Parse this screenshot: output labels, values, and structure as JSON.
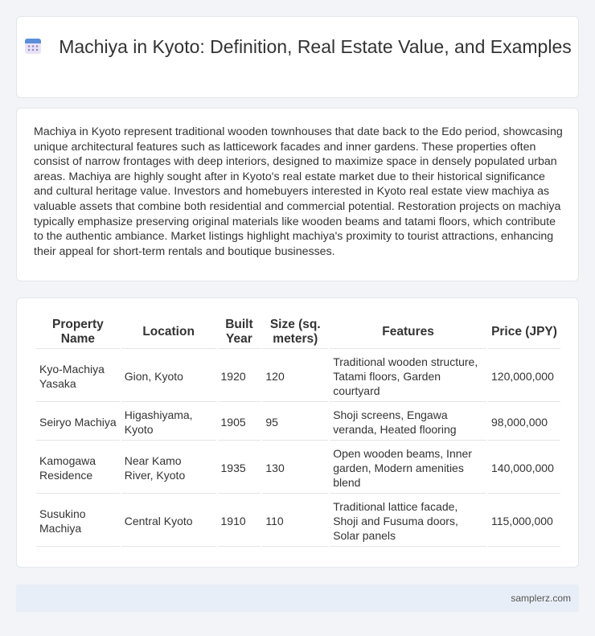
{
  "header": {
    "icon": "calendar-icon",
    "title": "Machiya in Kyoto: Definition, Real Estate Value, and Examples"
  },
  "summary": "Machiya in Kyoto represent traditional wooden townhouses that date back to the Edo period, showcasing unique architectural features such as latticework facades and inner gardens. These properties often consist of narrow frontages with deep interiors, designed to maximize space in densely populated urban areas. Machiya are highly sought after in Kyoto's real estate market due to their historical significance and cultural heritage value. Investors and homebuyers interested in Kyoto real estate view machiya as valuable assets that combine both residential and commercial potential. Restoration projects on machiya typically emphasize preserving original materials like wooden beams and tatami floors, which contribute to the authentic ambiance. Market listings highlight machiya's proximity to tourist attractions, enhancing their appeal for short-term rentals and boutique businesses.",
  "table": {
    "headers": [
      "Property Name",
      "Location",
      "Built Year",
      "Size (sq. meters)",
      "Features",
      "Price (JPY)"
    ],
    "rows": [
      [
        "Kyo-Machiya Yasaka",
        "Gion, Kyoto",
        "1920",
        "120",
        "Traditional wooden structure, Tatami floors, Garden courtyard",
        "120,000,000"
      ],
      [
        "Seiryo Machiya",
        "Higashiyama, Kyoto",
        "1905",
        "95",
        "Shoji screens, Engawa veranda, Heated flooring",
        "98,000,000"
      ],
      [
        "Kamogawa Residence",
        "Near Kamo River, Kyoto",
        "1935",
        "130",
        "Open wooden beams, Inner garden, Modern amenities blend",
        "140,000,000"
      ],
      [
        "Susukino Machiya",
        "Central Kyoto",
        "1910",
        "110",
        "Traditional lattice facade, Shoji and Fusuma doors, Solar panels",
        "115,000,000"
      ]
    ]
  },
  "footer": {
    "site": "samplerz.com"
  }
}
